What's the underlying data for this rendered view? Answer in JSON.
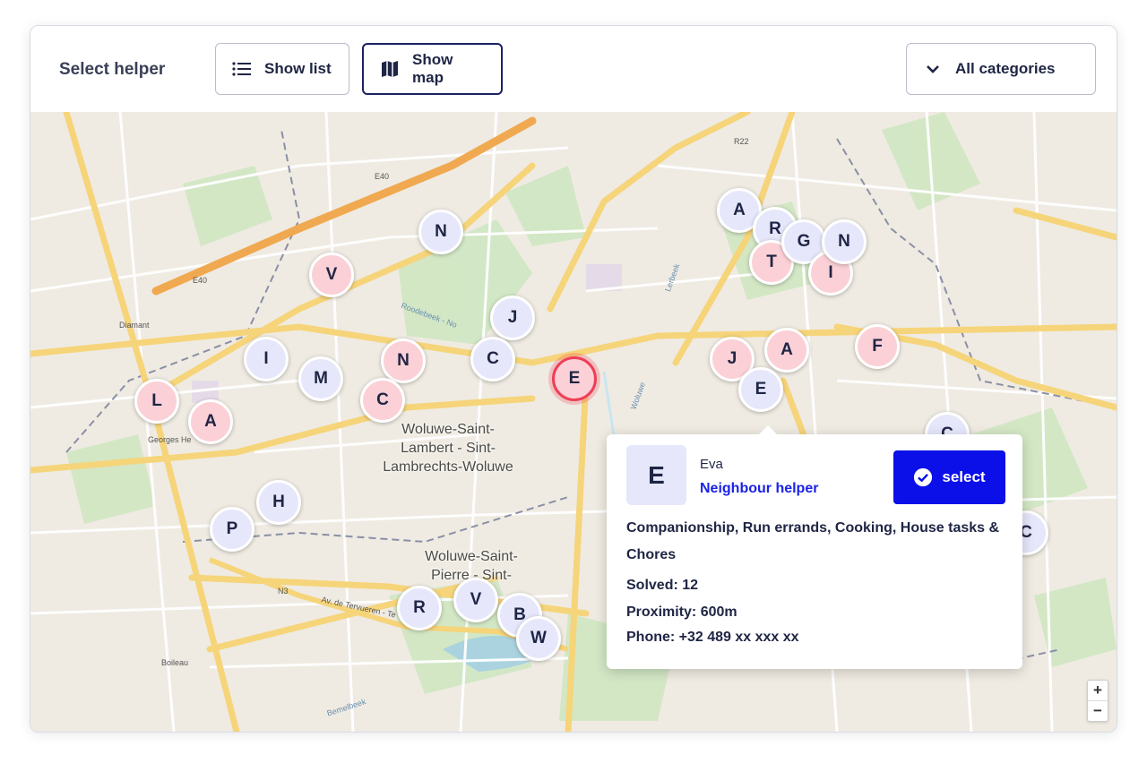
{
  "toolbar": {
    "title": "Select helper",
    "show_list_label": "Show list",
    "show_map_label": "Show map",
    "category_label": "All categories"
  },
  "map": {
    "area_label_1": "Woluwe-Saint-\nLambert - Sint-\nLambrechts-Woluwe",
    "area_label_2": "Woluwe-Saint-\nPierre - Sint-",
    "station_diamant": "Diamant",
    "station_georges": "Georges He",
    "station_boileau": "Boileau",
    "road_e40_a": "E40",
    "road_e40_b": "E40",
    "road_n3": "N3",
    "road_r22": "R22",
    "street_tervueren": "Av. de Tervueren - Te",
    "street_roodebeek": "Roodebeek - No",
    "street_woluwe": "Woluwe",
    "street_lerbeek": "Lerbeek",
    "street_bemelbeek": "Bemelbeek",
    "markers": [
      {
        "letter": "N",
        "color": "blue"
      },
      {
        "letter": "V",
        "color": "pink"
      },
      {
        "letter": "J",
        "color": "blue"
      },
      {
        "letter": "C",
        "color": "blue"
      },
      {
        "letter": "N",
        "color": "pink"
      },
      {
        "letter": "I",
        "color": "blue"
      },
      {
        "letter": "M",
        "color": "blue"
      },
      {
        "letter": "C",
        "color": "pink"
      },
      {
        "letter": "L",
        "color": "pink"
      },
      {
        "letter": "A",
        "color": "pink"
      },
      {
        "letter": "E",
        "color": "selected"
      },
      {
        "letter": "A",
        "color": "blue"
      },
      {
        "letter": "R",
        "color": "blue"
      },
      {
        "letter": "T",
        "color": "pink"
      },
      {
        "letter": "G",
        "color": "blue"
      },
      {
        "letter": "I",
        "color": "pink"
      },
      {
        "letter": "N",
        "color": "blue"
      },
      {
        "letter": "J",
        "color": "pink"
      },
      {
        "letter": "A",
        "color": "pink"
      },
      {
        "letter": "F",
        "color": "pink"
      },
      {
        "letter": "E",
        "color": "blue"
      },
      {
        "letter": "C",
        "color": "blue"
      },
      {
        "letter": "C",
        "color": "blue"
      },
      {
        "letter": "H",
        "color": "blue"
      },
      {
        "letter": "P",
        "color": "blue"
      },
      {
        "letter": "R",
        "color": "blue"
      },
      {
        "letter": "V",
        "color": "blue"
      },
      {
        "letter": "B",
        "color": "blue"
      },
      {
        "letter": "W",
        "color": "blue"
      }
    ],
    "zoom_in": "+",
    "zoom_out": "−"
  },
  "popup": {
    "avatar_letter": "E",
    "name": "Eva",
    "role": "Neighbour helper",
    "select_label": "select",
    "skills": "Companionship, Run errands, Cooking, House tasks & Chores",
    "solved": "Solved: 12",
    "proximity": "Proximity: 600m",
    "phone": "Phone: +32 489 xx xxx xx"
  },
  "colors": {
    "primary": "#0b0fe8",
    "marker_blue": "#e6e7fb",
    "marker_pink": "#fbd0d6",
    "selected_ring": "#ef3e57",
    "road": "#f6d47a"
  }
}
